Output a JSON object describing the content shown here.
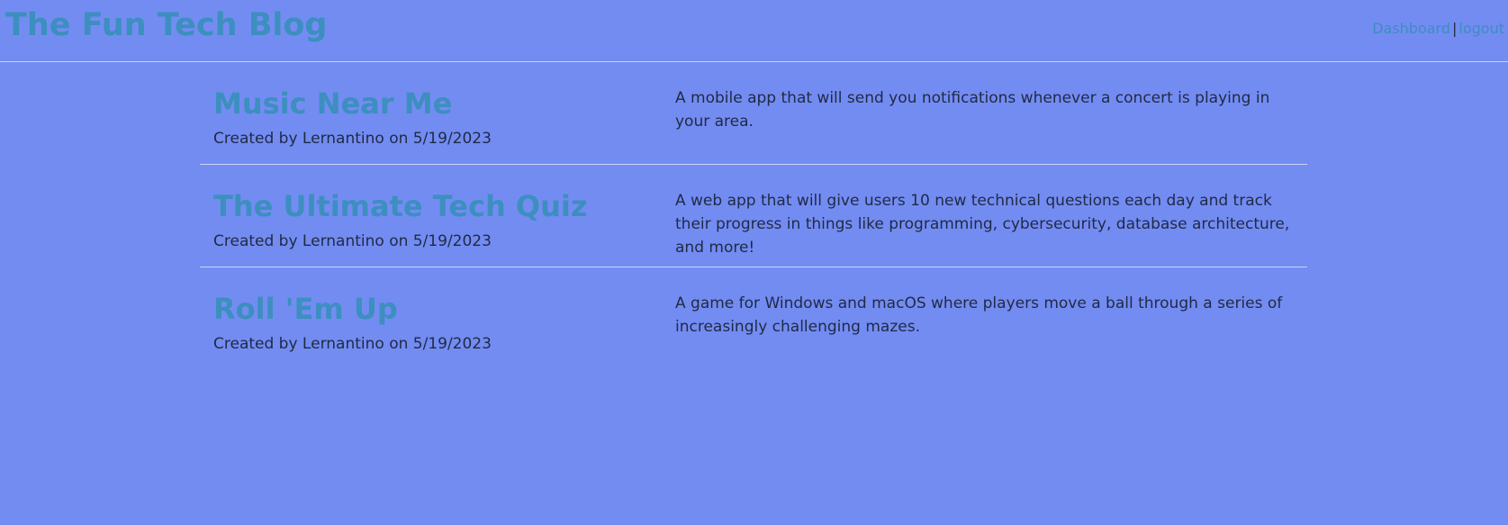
{
  "header": {
    "title": "The Fun Tech Blog",
    "nav": {
      "dashboard": "Dashboard",
      "separator": "|",
      "logout": "logout"
    }
  },
  "posts": [
    {
      "title": "Music Near Me",
      "meta": "Created by Lernantino on 5/19/2023",
      "description": "A mobile app that will send you notifications whenever a concert is playing in your area."
    },
    {
      "title": "The Ultimate Tech Quiz",
      "meta": "Created by Lernantino on 5/19/2023",
      "description": "A web app that will give users 10 new technical questions each day and track their progress in things like programming, cybersecurity, database architecture, and more!"
    },
    {
      "title": "Roll 'Em Up",
      "meta": "Created by Lernantino on 5/19/2023",
      "description": "A game for Windows and macOS where players move a ball through a series of increasingly challenging mazes."
    }
  ],
  "colors": {
    "background": "#738cf2",
    "accent": "#3c8fbe",
    "text": "#1f2a44",
    "divider": "#c9d1f5"
  }
}
